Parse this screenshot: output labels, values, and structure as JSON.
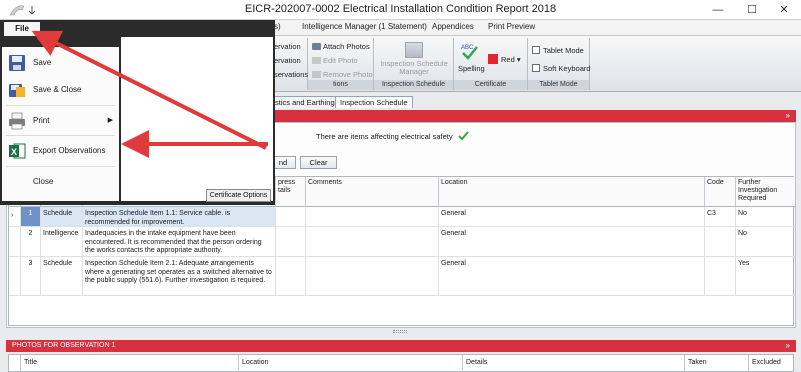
{
  "window": {
    "title": "EICR-202007-0002 Electrical Installation Condition Report 2018",
    "controls": {
      "minimize": "—",
      "maximize": "☐",
      "close": "✕"
    }
  },
  "ribbon_tabs": [
    "s)",
    "Intelligence Manager (1 Statement)",
    "Appendices",
    "Print Preview"
  ],
  "ribbon": {
    "observations_group": {
      "items": [
        "ervation",
        "ervation",
        "servations"
      ],
      "label": "tions"
    },
    "photos": {
      "attach": "Attach Photos",
      "edit": "Edit Photo",
      "remove": "Remove Photo"
    },
    "inspection_schedule": {
      "button": "Inspection Schedule Manager",
      "label": "Inspection Schedule"
    },
    "certificate": {
      "spelling": "Spelling",
      "color": "Red",
      "label": "Certificate"
    },
    "tablet": {
      "tablet_mode": "Tablet Mode",
      "soft_keyboard": "Soft Keyboard",
      "label": "Tablet Mode"
    }
  },
  "doc_tabs": [
    "stics and Earthing",
    "Inspection Schedule"
  ],
  "safety_message": "There are items affecting electrical safety",
  "buttons": {
    "find": "nd",
    "clear": "Clear"
  },
  "grid": {
    "columns": [
      "",
      "",
      "",
      "",
      "press\ntails",
      "Comments",
      "Location",
      "Code",
      "Further\nInvestigation\nRequired"
    ],
    "rows": [
      {
        "num": "1",
        "source": "Schedule",
        "text": "Inspection Schedule Item 1.1: Service cable. is recommended for improvement.",
        "comments": "",
        "location": "General",
        "code": "C3",
        "further": "No"
      },
      {
        "num": "2",
        "source": "Intelligence",
        "text": "Inadequacies in the intake equipment have been encountered.  It is recommended that the person ordering the works contacts the appropriate authority.",
        "comments": "",
        "location": "General",
        "code": "",
        "further": "No"
      },
      {
        "num": "3",
        "source": "Schedule",
        "text": "Inspection Schedule Item 2.1: Adequate arrangements where a generating set operates as a switched alternative to the public supply (551.6). Further investigation is required.",
        "comments": "",
        "location": "General",
        "code": "",
        "further": "Yes"
      }
    ]
  },
  "photos_section": {
    "title": "PHOTOS FOR OBSERVATION 1",
    "columns": [
      "Title",
      "Location",
      "Details",
      "Taken",
      "Excluded"
    ]
  },
  "file_menu": {
    "tab": "File",
    "items": [
      {
        "label": "Save",
        "icon": "save-icon"
      },
      {
        "label": "Save & Close",
        "icon": "save-close-icon"
      },
      {
        "label": "Print",
        "icon": "printer-icon",
        "submenu": true
      },
      {
        "label": "Export Observations",
        "icon": "excel-icon"
      },
      {
        "label": "Close",
        "icon": ""
      }
    ],
    "certificate_options": "Certificate Options"
  },
  "colors": {
    "section_red": "#d7303f",
    "selection_blue": "#6e93c8",
    "arrow_red": "#e03a3a",
    "excel_green": "#1e7145"
  }
}
